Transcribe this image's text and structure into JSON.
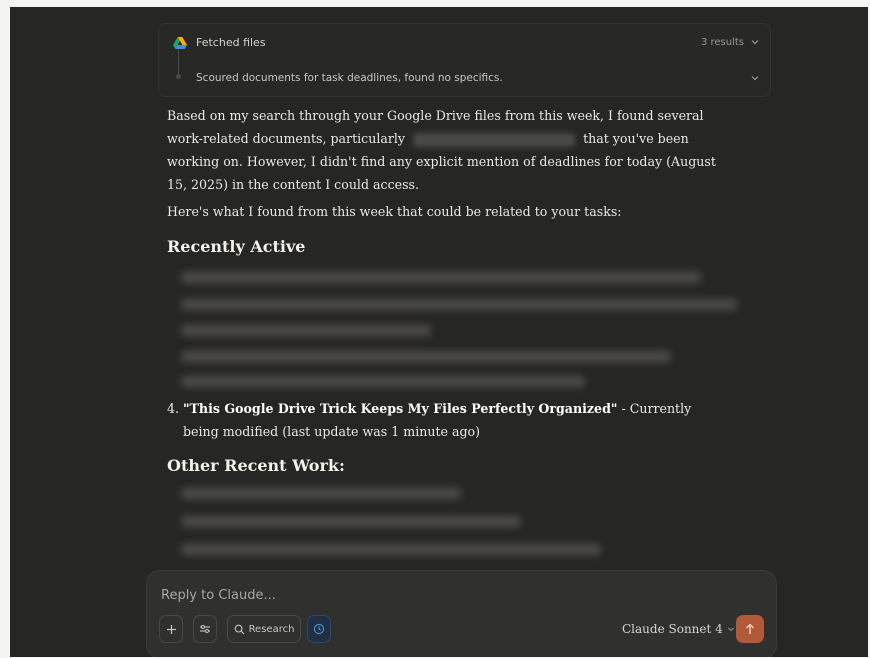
{
  "tool_card": {
    "title": "Fetched files",
    "results": "3 results",
    "subtitle": "Scoured documents for task deadlines, found no specifics."
  },
  "response": {
    "para1_a": "Based on my search through your Google Drive files from this week, I found several work-related documents, particularly",
    "para1_b": "that you've been working on. However, I didn't find any explicit mention of deadlines for today (August 15, 2025) in the content I could access.",
    "para2": "Here's what I found from this week that could be related to your tasks:",
    "heading1": "Recently Active",
    "item4_num": "4.",
    "item4_title": "\"This Google Drive Trick Keeps My Files Perfectly Organized\"",
    "item4_rest": " - Currently being modified (last update was 1 minute ago)",
    "heading2": "Other Recent Work:"
  },
  "composer": {
    "placeholder": "Reply to Claude...",
    "research_label": "Research",
    "model": "Claude Sonnet 4",
    "icons": [
      "plus-icon",
      "tools-icon",
      "research-icon",
      "clock-icon",
      "chevron-down-icon",
      "arrow-up-icon"
    ]
  },
  "colors": {
    "background": "#262624",
    "send": "#b05a3a",
    "text": "#ece9e1"
  }
}
